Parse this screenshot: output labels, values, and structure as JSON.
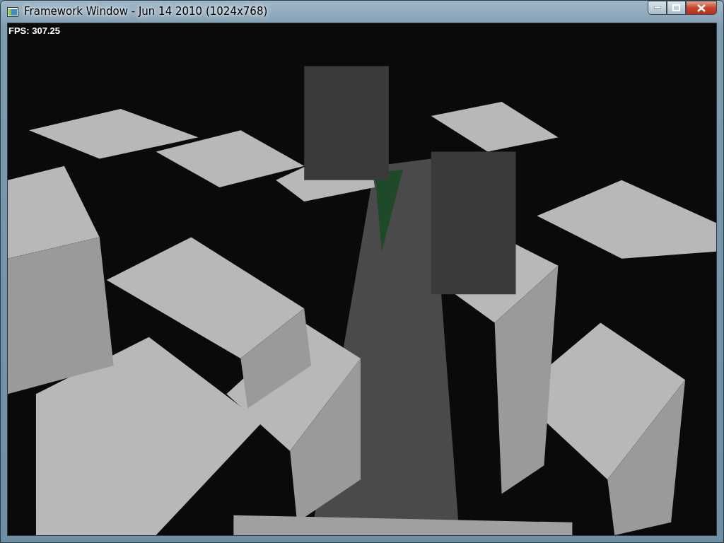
{
  "window": {
    "title": "Framework Window - Jun 14 2010 (1024x768)"
  },
  "viewport": {
    "fps": "FPS: 307.25"
  }
}
